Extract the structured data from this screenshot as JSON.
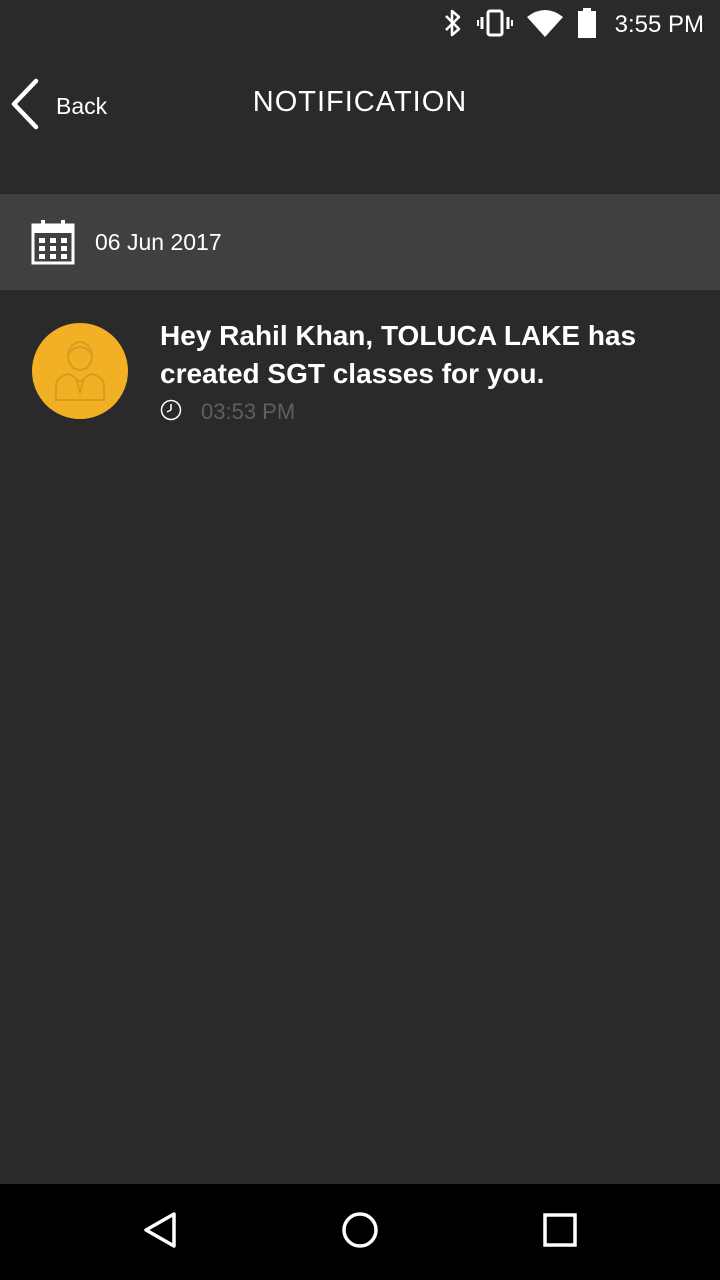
{
  "status_bar": {
    "time": "3:55 PM",
    "icons": [
      "bluetooth-icon",
      "vibrate-icon",
      "wifi-icon",
      "battery-icon"
    ]
  },
  "header": {
    "back_label": "Back",
    "title": "NOTIFICATION"
  },
  "date_group": {
    "icon": "calendar-icon",
    "date": "06 Jun 2017"
  },
  "notifications": [
    {
      "avatar_icon": "user-avatar-icon",
      "message": "Hey Rahil Khan, TOLUCA LAKE  has created SGT classes for you.",
      "time_icon": "clock-icon",
      "time": "03:53 PM"
    }
  ],
  "nav_bar": {
    "icons": [
      "back-triangle-icon",
      "home-circle-icon",
      "recents-square-icon"
    ]
  },
  "colors": {
    "background": "#2a2a2a",
    "date_bar": "#404040",
    "avatar_accent": "#f2b124",
    "muted_text": "#5f5f5f",
    "nav_bar": "#000000"
  }
}
